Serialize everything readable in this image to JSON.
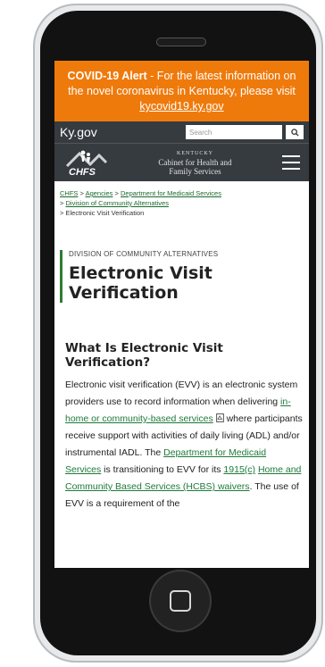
{
  "alert": {
    "title": "COVID-19 Alert",
    "text": " - For the latest information on the novel coronavirus in Kentucky, please visit ",
    "link": "kycovid19.ky.gov"
  },
  "header": {
    "site": "Ky.gov",
    "search_placeholder": "Search",
    "logo_text": "CHFS",
    "cabinet_state": "KENTUCKY",
    "cabinet_line1": "Cabinet for Health and",
    "cabinet_line2": "Family Services"
  },
  "breadcrumb": {
    "items": [
      "CHFS",
      "Agencies",
      "Department for Medicaid Services",
      "Division of Community Alternatives",
      "Electronic Visit Verification"
    ],
    "separator": ">"
  },
  "page": {
    "division": "DIVISION OF COMMUNITY ALTERNATIVES",
    "title": "Electronic Visit Verification",
    "heading": "What Is Electronic Visit Verification?",
    "para_1": "Electronic visit verification (EVV) is an electronic system providers use to record information when delivering ",
    "link_services": "in-home or community-based services",
    "para_2": " where participants receive support with activities of daily living (ADL) and/or instrumental IADL. The ",
    "link_dms": "Department for Medicaid Services",
    "para_3": " is transitioning to EVV for its ",
    "link_1915c": "1915(c)",
    "para_space": " ",
    "link_hcbs": "Home and Community Based Services (HCBS) waivers",
    "para_4": ". The use of EVV is  a requirement of the"
  },
  "colors": {
    "alert": "#ef7a0c",
    "header": "#363b40",
    "link": "#1e7a3a",
    "accent": "#2e7d32"
  }
}
